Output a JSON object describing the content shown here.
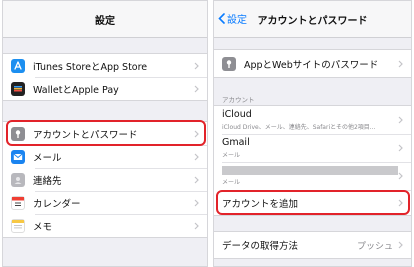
{
  "left": {
    "title": "設定",
    "group1": [
      {
        "label": "iTunes StoreとApp Store",
        "icon": "app-store-icon"
      },
      {
        "label": "WalletとApple Pay",
        "icon": "wallet-icon"
      }
    ],
    "group2": [
      {
        "label": "アカウントとパスワード",
        "icon": "key-icon"
      },
      {
        "label": "メール",
        "icon": "mail-icon"
      },
      {
        "label": "連絡先",
        "icon": "contacts-icon"
      },
      {
        "label": "カレンダー",
        "icon": "calendar-icon"
      },
      {
        "label": "メモ",
        "icon": "notes-icon"
      }
    ]
  },
  "right": {
    "back_label": "設定",
    "title": "アカウントとパスワード",
    "passwords_label": "AppとWebサイトのパスワード",
    "accounts_header": "アカウント",
    "accounts": [
      {
        "title": "iCloud",
        "subtitle": "iCloud Drive、メール、連絡先、Safariとその他2項目..."
      },
      {
        "title": "Gmail",
        "subtitle": "メール"
      },
      {
        "title": "",
        "subtitle": "メール"
      }
    ],
    "add_account_label": "アカウントを追加",
    "fetch_label": "データの取得方法",
    "fetch_value": "プッシュ"
  },
  "colors": {
    "accent": "#0a7cff",
    "highlight": "#e2232a"
  }
}
